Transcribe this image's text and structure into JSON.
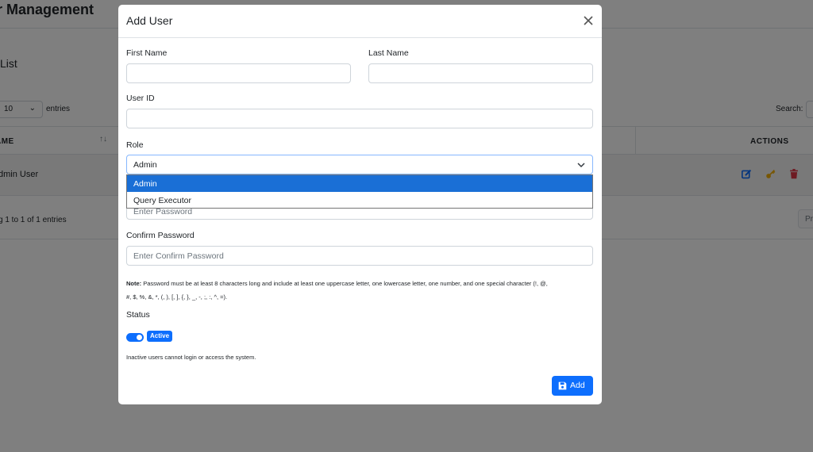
{
  "background": {
    "page_title": "r Management",
    "card_title": "List",
    "length_value": "10",
    "entries_label": "entries",
    "search_label": "Search:",
    "columns": {
      "name": "AME",
      "sort_glyph": "↑↓",
      "actions": "ACTIONS"
    },
    "rows": [
      {
        "name": "dmin User"
      }
    ],
    "info": "g 1 to 1 of 1 entries",
    "prev_label": "Pr"
  },
  "modal": {
    "title": "Add User",
    "first_name": {
      "label": "First Name",
      "value": ""
    },
    "last_name": {
      "label": "Last Name",
      "value": ""
    },
    "user_id": {
      "label": "User ID",
      "value": ""
    },
    "role": {
      "label": "Role",
      "selected": "Admin",
      "options": [
        "Admin",
        "Query Executor"
      ]
    },
    "password": {
      "placeholder": "Enter Password"
    },
    "confirm_password": {
      "label": "Confirm Password",
      "placeholder": "Enter Confirm Password"
    },
    "note": {
      "prefix": "Note:",
      "line1": " Password must be at least 8 characters long and include at least one uppercase letter, one lowercase letter, one number, and one special character (!, @,",
      "line2": "#, $, %, &, *, (, ), [, ], {, }, _, -, ;, :, ^, =)."
    },
    "status": {
      "label": "Status",
      "badge": "Active",
      "enabled": true,
      "help": "Inactive users cannot login or access the system."
    },
    "add_button": "Add"
  },
  "colors": {
    "primary": "#0d6efd",
    "selected_option": "#1a6fd6",
    "edit_icon": "#0d6efd",
    "key_icon": "#f0ad00",
    "delete_icon": "#dc3545"
  }
}
